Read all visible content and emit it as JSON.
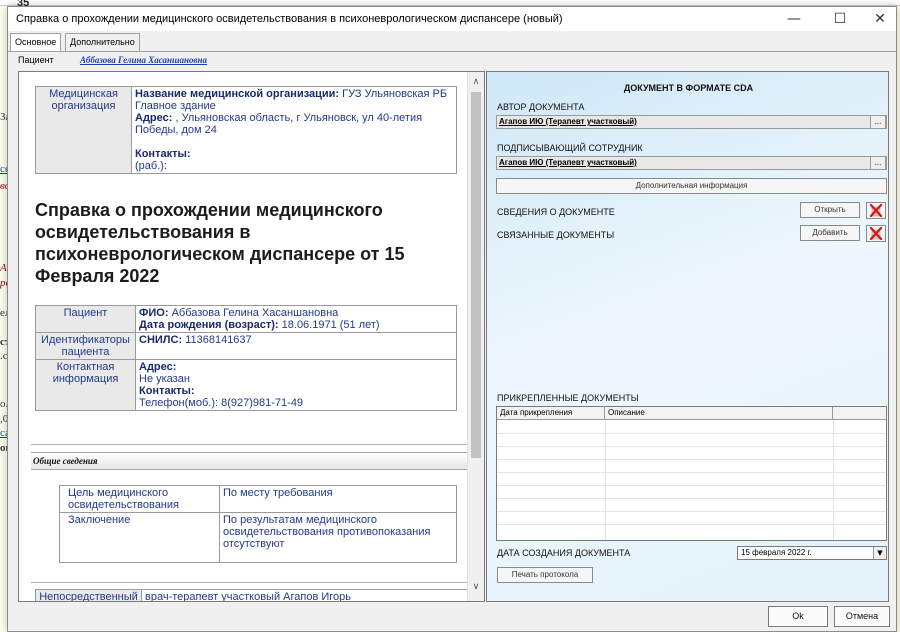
{
  "background": {
    "number": "35",
    "frag1": "За",
    "frag2": "се",
    "frag3": "во",
    "frag4": "А",
    "frag5": "ро",
    "frag6": "ел",
    "frag7": "ст",
    "frag8": ".с",
    "frag9": "о.",
    "frag10": ",0",
    "frag11": "са",
    "frag12": "ок"
  },
  "dialog": {
    "title": "Справка о прохождении медицинского освидетельствования в психоневрологическом диспансере (новый)",
    "tabs": [
      "Основное",
      "Дополнительно"
    ],
    "patient_label": "Пациент",
    "patient_name": "Аббазова Гелина Хасаншановна"
  },
  "document": {
    "org_label": "Медицинская организация",
    "org_name_label": "Название медицинской организации:",
    "org_name": " ГУЗ Ульяновская РБ Главное здание",
    "org_addr_label": "Адрес:",
    "org_addr": " , Ульяновская область, г Ульяновск, ул 40-летия Победы, дом 24",
    "org_contacts_label": "Контакты:",
    "org_contacts": "(раб.):",
    "heading": "Справка о прохождении медицинского освидетельствования в психоневрологическом диспансере от 15 Февраля 2022",
    "patient_label": "Пациент",
    "fio_label": "ФИО:",
    "fio": " Аббазова Гелина Хасаншановна",
    "dob_label": "Дата рождения (возраст):",
    "dob": " 18.06.1971 (51 лет)",
    "ids_label": "Идентификаторы пациента",
    "snils_label": "СНИЛС:",
    "snils": " 11368141637",
    "contact_label": "Контактная информация",
    "addr_label": "Адрес:",
    "addr": "Не указан",
    "contacts_label": "Контакты:",
    "phone": "Телефон(моб.): 8(927)981-71-49",
    "general_section": "Общие сведения",
    "purpose_label": "Цель медицинского освидетельствования",
    "purpose": "По месту требования",
    "conclusion_label": "Заключение",
    "conclusion": "По результатам медицинского освидетельствования противопоказания отсутствуют",
    "direct_label": "Непосредственный",
    "direct_value": "врач-терапевт участковый Агапов Игорь"
  },
  "cda": {
    "heading": "ДОКУМЕНТ В ФОРМАТЕ CDA",
    "author_label": "АВТОР ДОКУМЕНТА",
    "author": "Агапов ИЮ (Терапевт участковый)",
    "signer_label": "ПОДПИСЫВАЮЩИЙ СОТРУДНИК",
    "signer": "Агапов ИЮ (Терапевт участковый)",
    "dots": "...",
    "extra_info_button": "Дополнительная информация",
    "doc_info_label": "СВЕДЕНИЯ О ДОКУМЕНТЕ",
    "open_button": "Открыть",
    "related_label": "СВЯЗАННЫЕ ДОКУМЕНТЫ",
    "add_button": "Добавить",
    "attached_label": "ПРИКРЕПЛЕННЫЕ ДОКУМЕНТЫ",
    "col_date": "Дата прикрепления",
    "col_desc": "Описание",
    "created_label": "ДАТА СОЗДАНИЯ ДОКУМЕНТА",
    "created_date": "15 февраля  2022 г.",
    "print_button": "Печать протокола"
  },
  "footer": {
    "ok": "Ok",
    "cancel": "Отмена"
  },
  "colors": {
    "accent_link": "#1a3fb0",
    "delete_icon": "#d01818"
  }
}
